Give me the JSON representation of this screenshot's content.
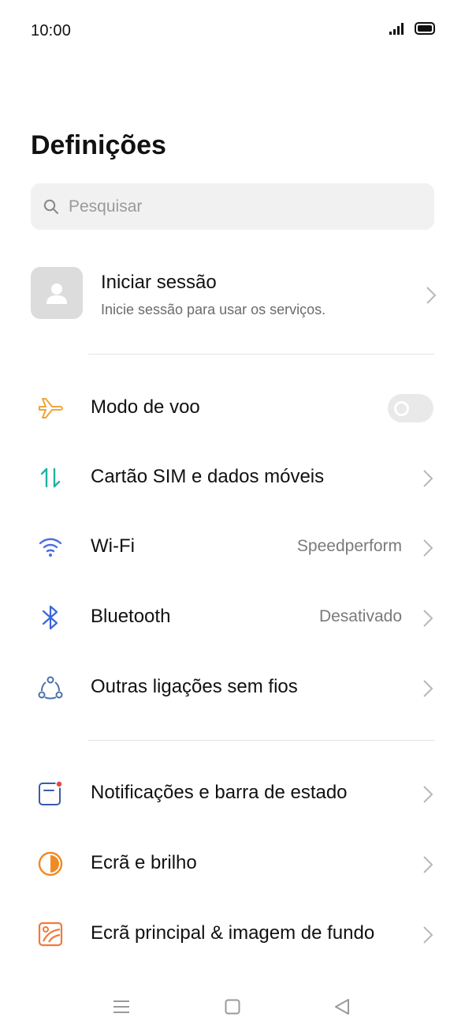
{
  "status_bar": {
    "time": "10:00",
    "icons": [
      "signal-icon",
      "battery-icon"
    ]
  },
  "header": {
    "title": "Definições"
  },
  "search": {
    "placeholder": "Pesquisar",
    "value": ""
  },
  "account": {
    "title": "Iniciar sessão",
    "subtitle": "Inicie sessão para usar os serviços."
  },
  "groups": [
    {
      "items": [
        {
          "label": "Modo de voo",
          "icon": "airplane-icon",
          "control": "toggle",
          "toggle_on": false,
          "color": "#f0a43a"
        },
        {
          "label": "Cartão SIM e dados móveis",
          "icon": "sim-data-icon",
          "color": "#1fb3a0"
        },
        {
          "label": "Wi-Fi",
          "value": "Speedperform",
          "icon": "wifi-icon",
          "color": "#4a6fe0"
        },
        {
          "label": "Bluetooth",
          "value": "Desativado",
          "icon": "bluetooth-icon",
          "color": "#3a66d9"
        },
        {
          "label": "Outras ligações sem fios",
          "icon": "wireless-connections-icon",
          "color": "#4a6fa8"
        }
      ]
    },
    {
      "items": [
        {
          "label": "Notificações e barra de estado",
          "icon": "notifications-icon",
          "color": "#3b5aa8"
        },
        {
          "label": "Ecrã e brilho",
          "icon": "display-brightness-icon",
          "color": "#f08a24"
        },
        {
          "label": "Ecrã principal & imagem de fundo",
          "icon": "wallpaper-icon",
          "color": "#f07a3a"
        }
      ]
    }
  ],
  "nav_bar": {
    "buttons": [
      "menu-icon",
      "home-icon",
      "back-icon"
    ]
  }
}
